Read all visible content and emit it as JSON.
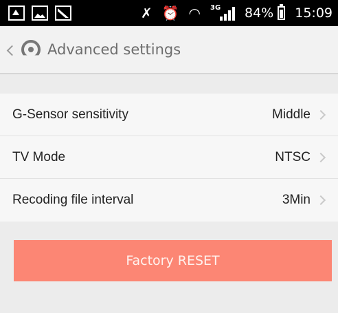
{
  "status_bar": {
    "battery_percent": "84%",
    "time": "15:09",
    "network": "3G",
    "icons_left": [
      "app-notification-icon",
      "image-icon",
      "satellite-icon"
    ],
    "icons_right": [
      "mute-icon",
      "alarm-icon",
      "wifi-icon",
      "signal-icon",
      "battery-icon"
    ]
  },
  "header": {
    "title": "Advanced settings",
    "back_icon": "chevron-left-icon",
    "logo_icon": "app-logo-icon"
  },
  "settings": {
    "items": [
      {
        "label": "G-Sensor sensitivity",
        "value": "Middle"
      },
      {
        "label": "TV Mode",
        "value": "NTSC"
      },
      {
        "label": "Recoding file interval",
        "value": "3Min"
      }
    ]
  },
  "actions": {
    "reset_label": "Factory RESET",
    "reset_color": "#fc8674"
  }
}
